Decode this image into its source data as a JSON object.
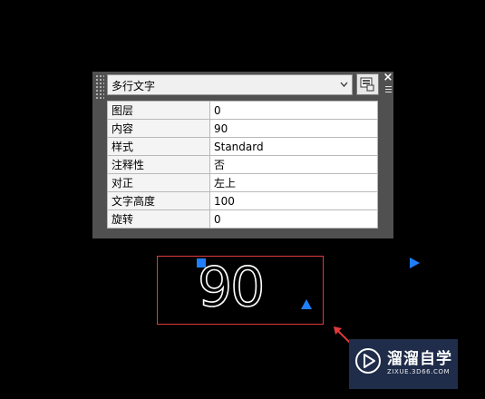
{
  "palette": {
    "object_type": "多行文字",
    "close_glyph": "×",
    "properties": [
      {
        "name": "图层",
        "value": "0"
      },
      {
        "name": "内容",
        "value": "90"
      },
      {
        "name": "样式",
        "value": "Standard"
      },
      {
        "name": "注释性",
        "value": "否"
      },
      {
        "name": "对正",
        "value": "左上"
      },
      {
        "name": "文字高度",
        "value": "100"
      },
      {
        "name": "旋转",
        "value": "0"
      }
    ]
  },
  "canvas": {
    "mtext_content": "90",
    "selection_color": "#e0393b",
    "grip_color": "#1f7fff"
  },
  "watermark": {
    "brand": "溜溜自学",
    "site": "ZIXUE.3D66.COM"
  }
}
